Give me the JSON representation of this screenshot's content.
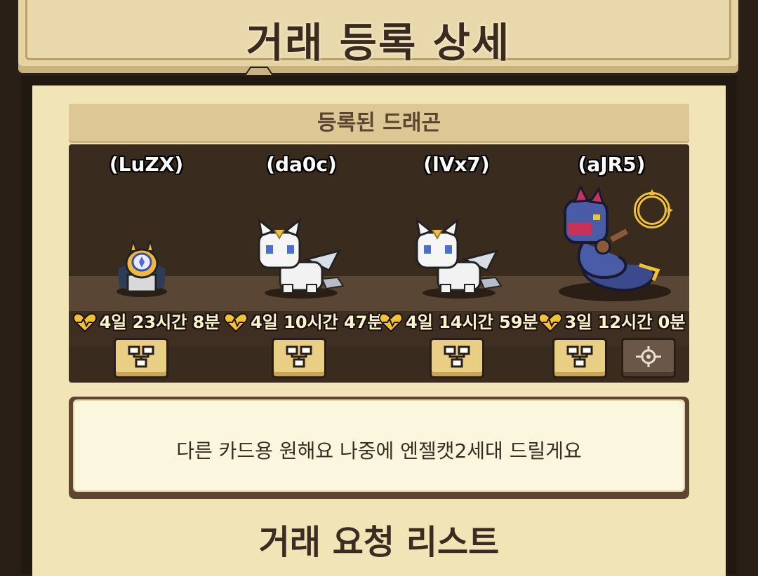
{
  "header": {
    "title": "거래 등록 상세"
  },
  "registered": {
    "section_title": "등록된 드래곤",
    "dragons": [
      {
        "name": "(LuZX)",
        "time_left": "4일 23시간 8분",
        "sprite": "egg-sprite",
        "actions": [
          "lineage-icon"
        ]
      },
      {
        "name": "(da0c)",
        "time_left": "4일 10시간 47분",
        "sprite": "white-cat-dragon-sprite",
        "actions": [
          "lineage-icon"
        ]
      },
      {
        "name": "(lVx7)",
        "time_left": "4일 14시간 59분",
        "sprite": "white-cat-dragon-sprite",
        "actions": [
          "lineage-icon"
        ]
      },
      {
        "name": "(aJR5)",
        "time_left": "3일 12시간 0분",
        "sprite": "blue-serpent-dragon-sprite",
        "actions": [
          "lineage-icon",
          "locate-icon"
        ]
      }
    ]
  },
  "message": {
    "text": "다른 카드용 원해요 나중에 엔젤캣2세대 드릴게요"
  },
  "request_list": {
    "title": "거래 요청 리스트"
  },
  "colors": {
    "heart": "#f2c230",
    "panel": "#f1e4b7",
    "dark_bg": "#3a2b1f"
  }
}
